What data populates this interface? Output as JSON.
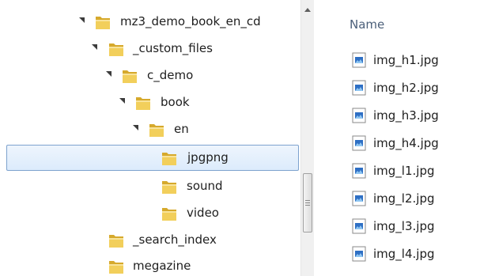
{
  "tree": {
    "items": [
      {
        "label": "mz3_demo_book_en_cd",
        "expanded": true,
        "selected": false
      },
      {
        "label": "_custom_files",
        "expanded": true,
        "selected": false
      },
      {
        "label": "c_demo",
        "expanded": true,
        "selected": false
      },
      {
        "label": "book",
        "expanded": true,
        "selected": false
      },
      {
        "label": "en",
        "expanded": true,
        "selected": false
      },
      {
        "label": "jpgpng",
        "expanded": false,
        "selected": true
      },
      {
        "label": "sound",
        "expanded": false,
        "selected": false
      },
      {
        "label": "video",
        "expanded": false,
        "selected": false
      },
      {
        "label": "_search_index",
        "expanded": false,
        "selected": false
      },
      {
        "label": "megazine",
        "expanded": false,
        "selected": false
      }
    ]
  },
  "file_list": {
    "column_header": "Name",
    "files": [
      {
        "name": "img_h1.jpg"
      },
      {
        "name": "img_h2.jpg"
      },
      {
        "name": "img_h3.jpg"
      },
      {
        "name": "img_h4.jpg"
      },
      {
        "name": "img_l1.jpg"
      },
      {
        "name": "img_l2.jpg"
      },
      {
        "name": "img_l3.jpg"
      },
      {
        "name": "img_l4.jpg"
      }
    ]
  },
  "colors": {
    "folder": "#e8c04a",
    "selection_border": "#7da2ce",
    "header_text": "#4c607a",
    "file_icon": "#2e6fc4"
  },
  "icons": {
    "expander": "expanded-arrow-icon",
    "folder": "folder-icon",
    "file": "jpeg-file-icon"
  }
}
